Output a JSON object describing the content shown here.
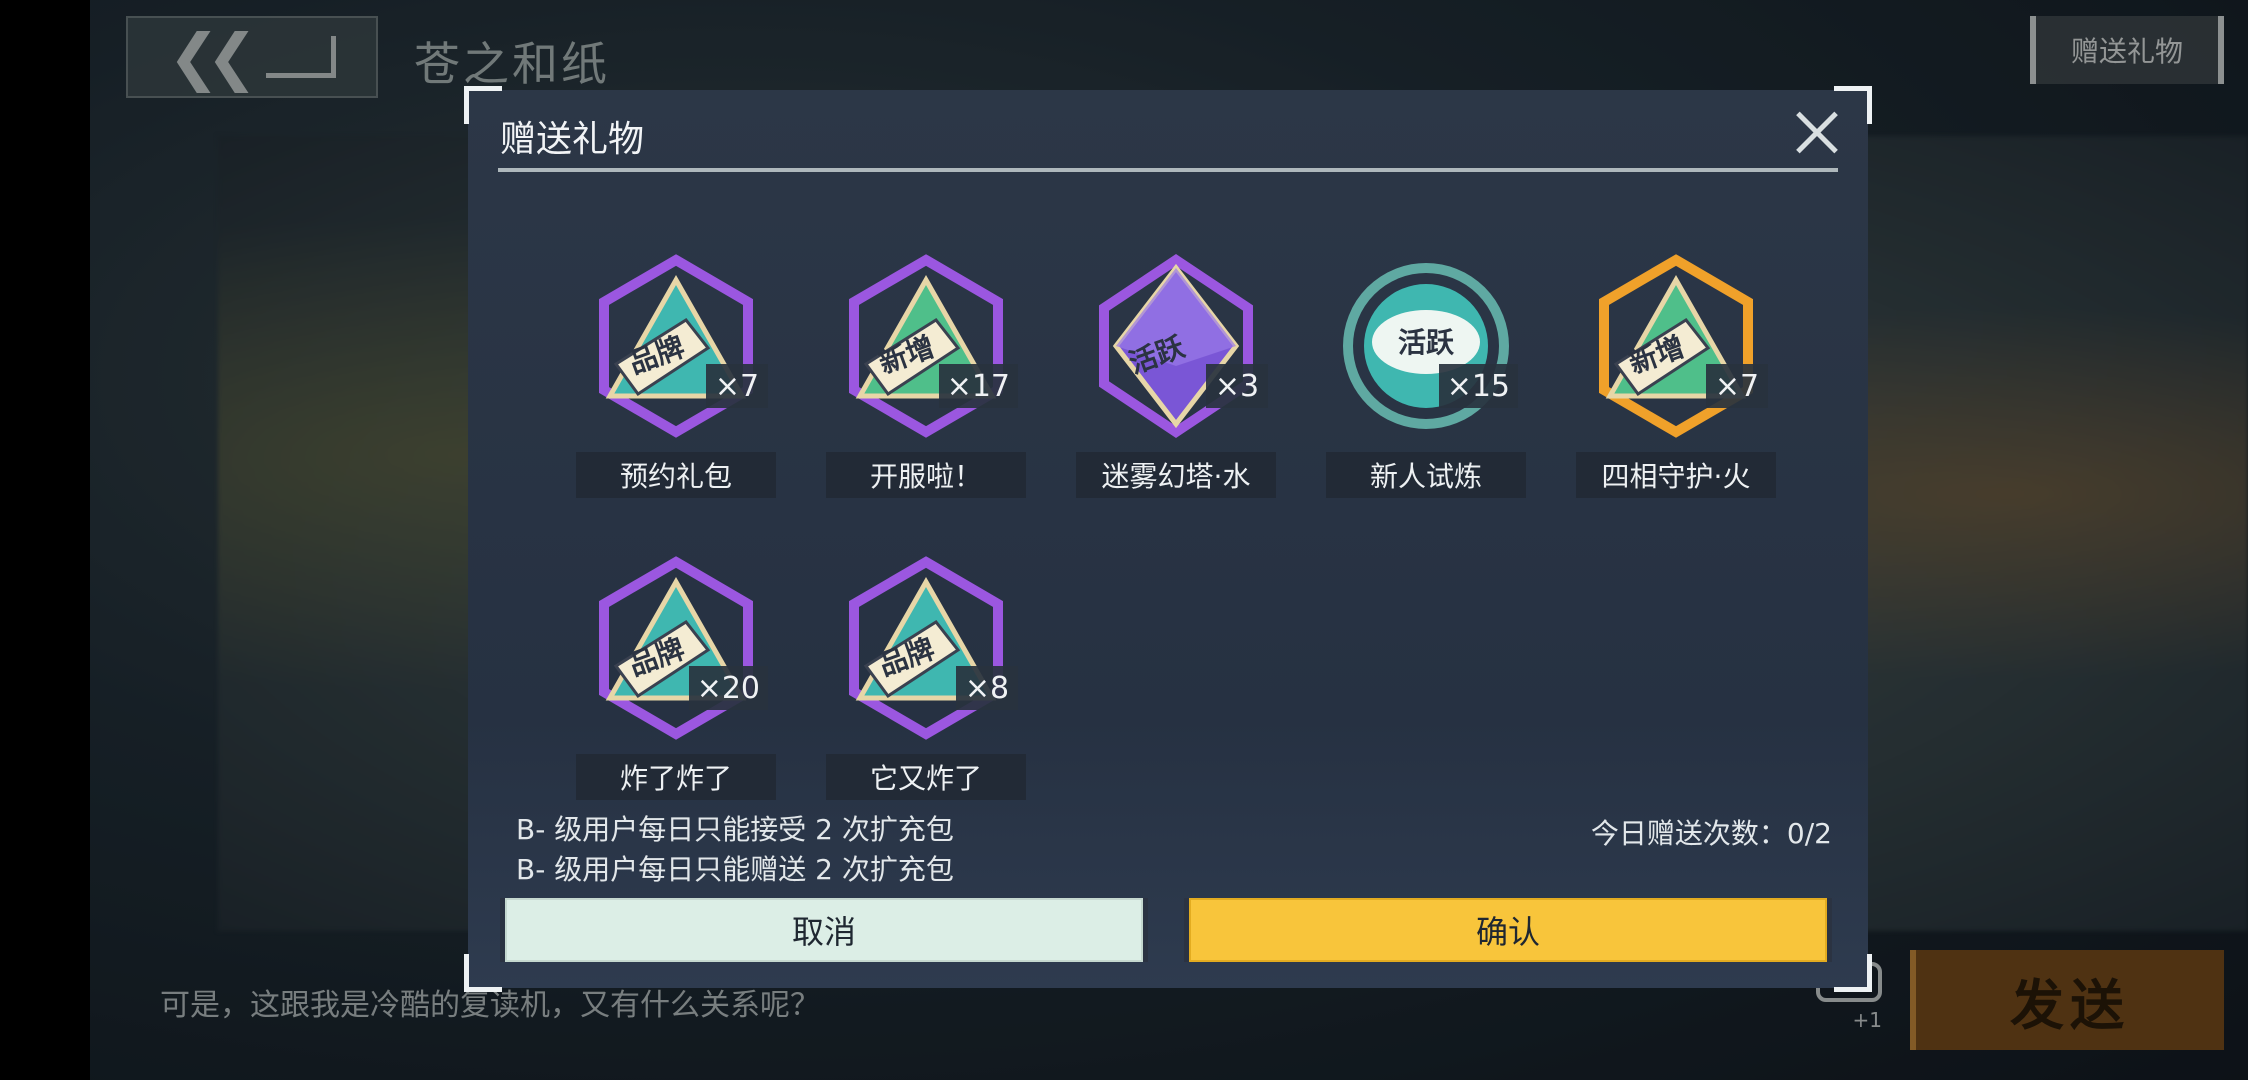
{
  "header": {
    "chat_title": "苍之和纸",
    "gift_button_label": "赠送礼物"
  },
  "chat": {
    "message_text": "可是，这跟我是冷酷的复读机，又有什么关系呢？",
    "send_label": "发送",
    "emoji_badge": "+1"
  },
  "modal": {
    "title": "赠送礼物",
    "gifts": [
      {
        "tag": "品牌",
        "count": "×7",
        "name": "预约礼包",
        "color": "#3fb7b0",
        "frame": "#9b57e0",
        "shape": "hexagon"
      },
      {
        "tag": "新增",
        "count": "×17",
        "name": "开服啦！",
        "color": "#4fbf8a",
        "frame": "#9b57e0",
        "shape": "hexagon"
      },
      {
        "tag": "活跃",
        "count": "×3",
        "name": "迷雾幻塔·水",
        "color": "#7a56d6",
        "frame": "#9b57e0",
        "shape": "octahedron"
      },
      {
        "tag": "活跃",
        "count": "×15",
        "name": "新人试炼",
        "color": "#3fb7b0",
        "frame": "#5fa9a2",
        "shape": "circle"
      },
      {
        "tag": "新增",
        "count": "×7",
        "name": "四相守护·火",
        "color": "#4fbf8a",
        "frame": "#f0a12a",
        "shape": "hexagon"
      },
      {
        "tag": "品牌",
        "count": "×20",
        "name": "炸了炸了",
        "color": "#3fb7b0",
        "frame": "#9b57e0",
        "shape": "hexagon"
      },
      {
        "tag": "品牌",
        "count": "×8",
        "name": "它又炸了",
        "color": "#3fb7b0",
        "frame": "#9b57e0",
        "shape": "hexagon"
      }
    ],
    "rule_line_1": "B- 级用户每日只能接受 2 次扩充包",
    "rule_line_2": "B- 级用户每日只能赠送 2 次扩充包",
    "daily_count": "今日赠送次数：0/2",
    "cancel_label": "取消",
    "confirm_label": "确认"
  }
}
